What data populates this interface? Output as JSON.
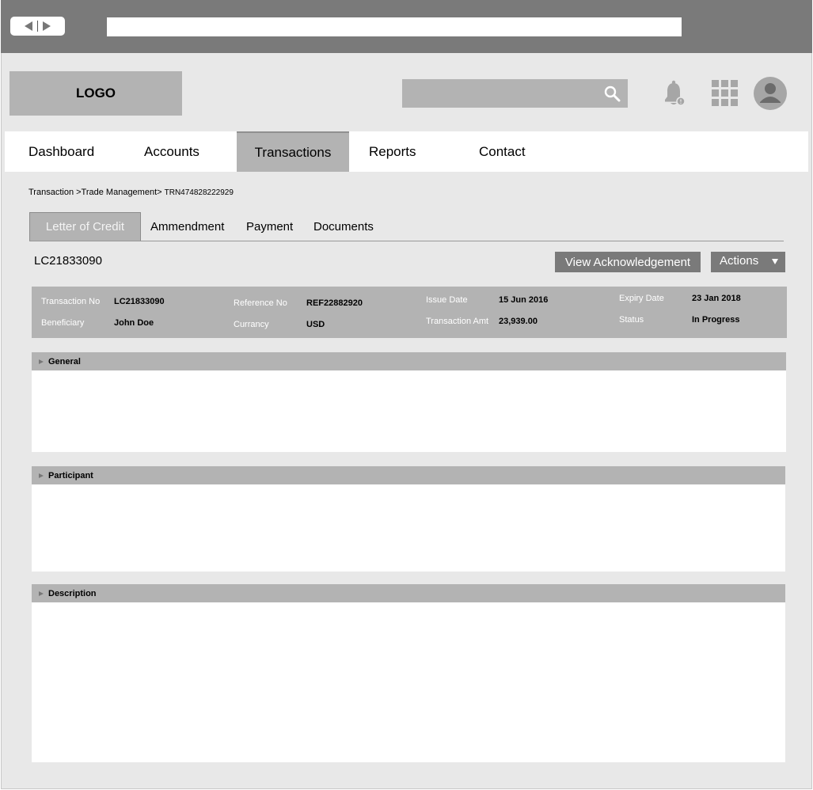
{
  "header": {
    "logo_text": "LOGO"
  },
  "nav": {
    "items": [
      {
        "label": "Dashboard"
      },
      {
        "label": "Accounts"
      },
      {
        "label": "Transactions"
      },
      {
        "label": "Reports"
      },
      {
        "label": "Contact"
      }
    ],
    "active": "Transactions"
  },
  "breadcrumb": {
    "parent": "Transaction >Trade Management>",
    "current": "TRN474828222929"
  },
  "tabs": [
    {
      "label": "Letter of Credit"
    },
    {
      "label": "Ammendment"
    },
    {
      "label": "Payment"
    },
    {
      "label": "Documents"
    }
  ],
  "active_tab": "Letter of Credit",
  "page": {
    "title": "LC21833090",
    "view_ack_label": "View Acknowledgement",
    "actions_label": "Actions"
  },
  "summary": {
    "transaction_no": {
      "label": "Transaction No",
      "value": "LC21833090"
    },
    "beneficiary": {
      "label": "Beneficiary",
      "value": "John Doe"
    },
    "reference_no": {
      "label": "Reference No",
      "value": "REF22882920"
    },
    "currency": {
      "label": "Currancy",
      "value": "USD"
    },
    "issue_date": {
      "label": "Issue Date",
      "value": "15 Jun 2016"
    },
    "transaction_amt": {
      "label": "Transaction Amt",
      "value": "23,939.00"
    },
    "expiry_date": {
      "label": "Expiry Date",
      "value": "23 Jan 2018"
    },
    "status": {
      "label": "Status",
      "value": "In Progress"
    }
  },
  "sections": [
    {
      "title": "General"
    },
    {
      "title": "Participant"
    },
    {
      "title": "Description"
    }
  ],
  "colors": {
    "chrome": "#7a7a7a",
    "panel_gray": "#b3b3b3",
    "background": "#e8e8e8"
  }
}
